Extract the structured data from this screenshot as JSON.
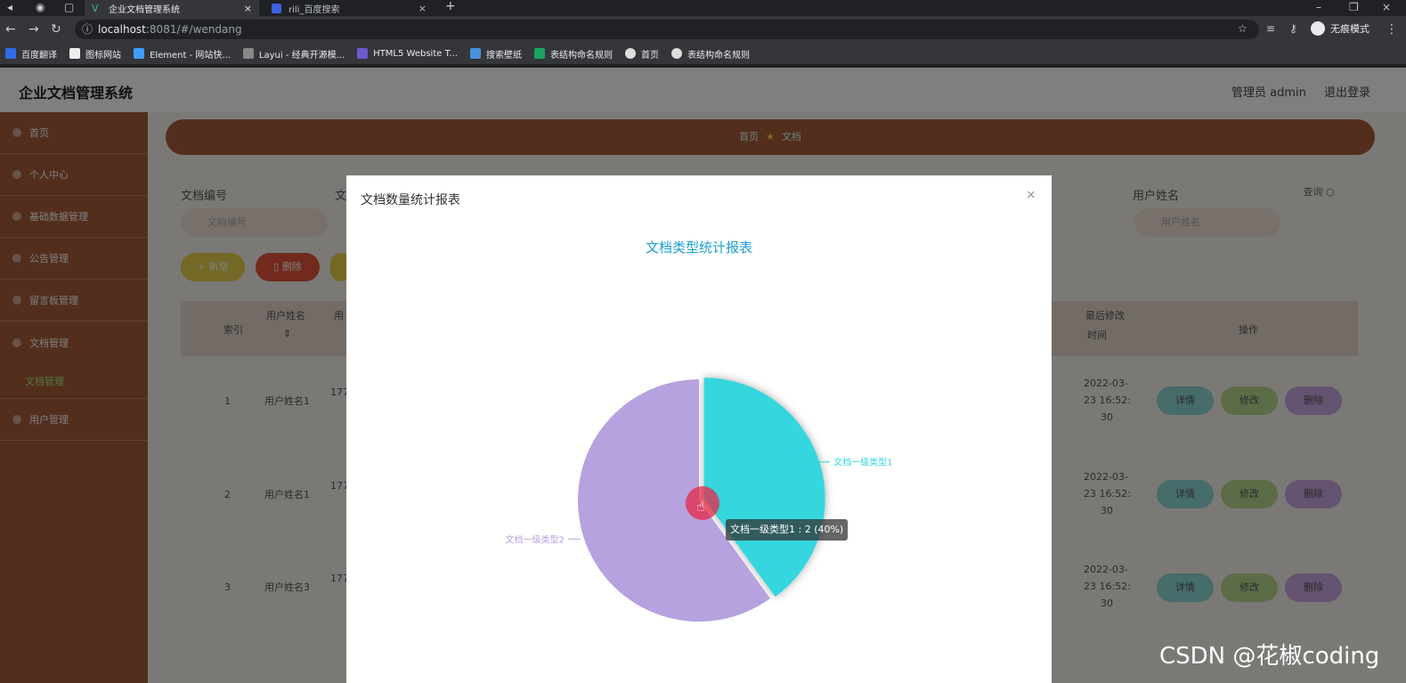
{
  "browser": {
    "active_tab": "企业文档管理系统",
    "inactive_tab": "rili_百度搜索",
    "url_host": "localhost",
    "url_rest": ":8081/#/wendang",
    "incognito": "无痕模式",
    "bookmarks": [
      "百度翻译",
      "图标网站",
      "Element - 网站快...",
      "Layui - 经典开源模...",
      "HTML5 Website T...",
      "搜索壁纸",
      "表结构命名规则",
      "首页",
      "表结构命名规则"
    ]
  },
  "app": {
    "title": "企业文档管理系统",
    "user": "管理员 admin",
    "logout": "退出登录",
    "sidebar": [
      "首页",
      "个人中心",
      "基础数据管理",
      "公告管理",
      "留言板管理",
      "文档管理"
    ],
    "sidebar_sub": "文档管理",
    "sidebar_last": "用户管理",
    "breadcrumb_home": "首页",
    "breadcrumb_current": "文档",
    "search": {
      "label_1": "文档编号",
      "label_2": "文",
      "label_3": "用户姓名",
      "placeholder_1": "文档编号",
      "placeholder_3": "用户姓名",
      "query": "查询"
    },
    "actions": {
      "add": "新增",
      "delete": "删除"
    },
    "table": {
      "col_index": "索引",
      "col_user_1": "用户姓名",
      "col_user_2": "用",
      "col_time_1": "最后修改",
      "col_time_2": "时间",
      "col_ops": "操作",
      "rows": [
        {
          "index": "1",
          "user": "用户姓名1",
          "phone": "177",
          "time_1": "2022-03-",
          "time_2": "23 16:52:",
          "time_3": "30"
        },
        {
          "index": "2",
          "user": "用户姓名1",
          "phone": "177",
          "time_1": "2022-03-",
          "time_2": "23 16:52:",
          "time_3": "30"
        },
        {
          "index": "3",
          "user": "用户姓名3",
          "phone": "177",
          "time_1": "2022-03-",
          "time_2": "23 16:52:",
          "time_3": "30"
        }
      ],
      "btn_detail": "详情",
      "btn_edit": "修改",
      "btn_delete": "删除"
    }
  },
  "modal": {
    "title": "文档数量统计报表",
    "close_icon": "close-icon"
  },
  "chart_data": {
    "type": "pie",
    "title": "文档类型统计报表",
    "slices": [
      {
        "name": "文档一级类型1",
        "value": 2,
        "percent": 40,
        "color": "#35d6dd"
      },
      {
        "name": "文档一级类型2",
        "value": 3,
        "percent": 60,
        "color": "#b6a2de"
      }
    ],
    "tooltip": "文档一级类型1 : 2 (40%)"
  },
  "watermark": "CSDN @花椒coding"
}
